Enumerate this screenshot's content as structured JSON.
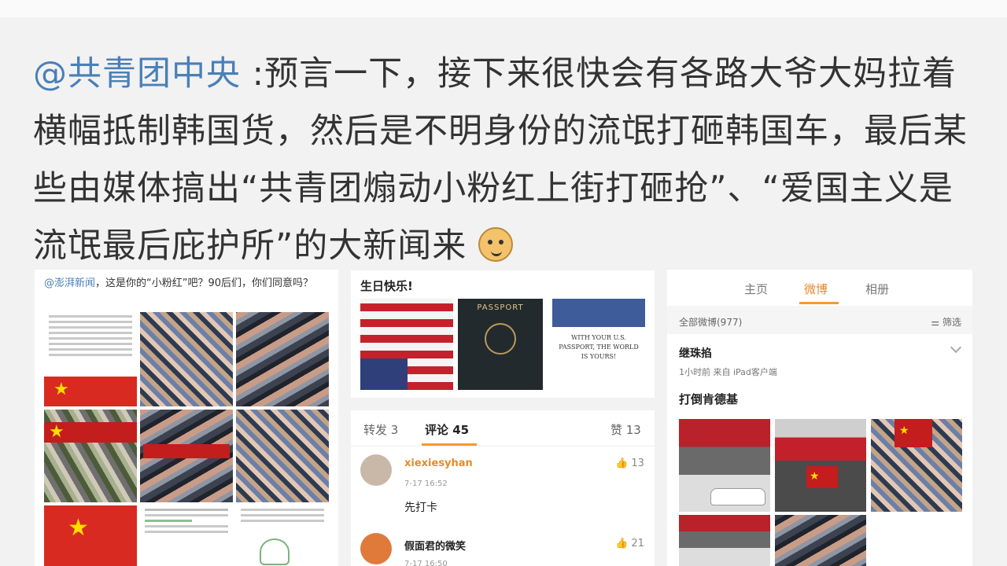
{
  "post": {
    "mention": "@共青团中央",
    "text": " :预言一下，接下来很快会有各路大爷大妈拉着横幅抵制韩国货，然后是不明身份的流氓打砸韩国车，最后某些由媒体搞出“共青团煽动小粉红上街打砸抢”、“爱国主义是流氓最后庇护所”的大新闻来",
    "emoji": "doge-emoji"
  },
  "left_card": {
    "mention": "@澎湃新闻",
    "text": "，这是你的“小粉红”吧？90后们，你们同意吗？"
  },
  "mid_card": {
    "title": "生日快乐!",
    "passport_label": "PASSPORT",
    "passport_caption": "WITH YOUR U.S. PASSPORT, THE WORLD IS YOURS!"
  },
  "comments_panel": {
    "tabs": [
      "转发 3",
      "评论 45",
      "赞 13"
    ],
    "comments": [
      {
        "name": "xiexiesyhan",
        "time": "7-17 16:52",
        "text": "先打卡",
        "likes": "13"
      },
      {
        "name": "假面君的微笑",
        "time": "7-17 16:50",
        "likes": "21"
      }
    ]
  },
  "profile_panel": {
    "tabs": [
      "主页",
      "微博",
      "相册"
    ],
    "count_label": "全部微博(977)",
    "filter_label": "筛选",
    "user": "继珠掐",
    "meta": "1小时前 来自 iPad客户端",
    "body": "打倒肯德基"
  }
}
